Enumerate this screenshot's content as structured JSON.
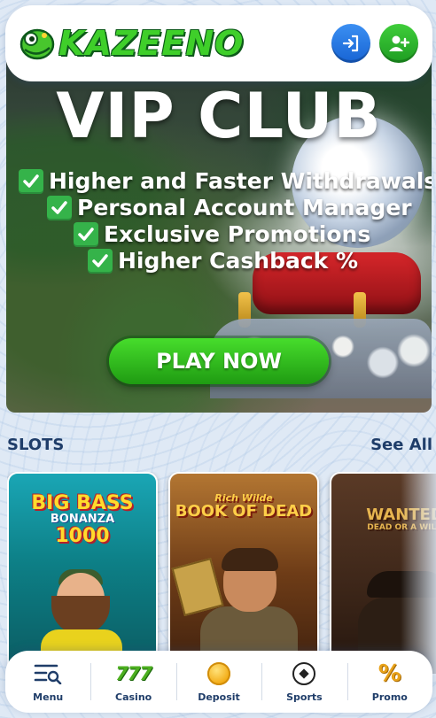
{
  "header": {
    "logo_text": "KAZEENO",
    "login_icon": "login-icon",
    "register_icon": "add-user-icon"
  },
  "banner": {
    "title": "VIP CLUB",
    "benefits": [
      "Higher and Faster  Withdrawals",
      "Personal  Account Manager",
      "Exclusive  Promotions",
      "Higher  Cashback %"
    ],
    "cta_label": "PLAY NOW"
  },
  "slots": {
    "section_title": "SLOTS",
    "see_all_label": "See All",
    "games": [
      {
        "title_line1": "BIG BASS",
        "title_line2": "BONANZA",
        "title_line3": "1000"
      },
      {
        "title_line1": "Rich Wilde",
        "title_line2": "BOOK OF DEAD"
      },
      {
        "title_line1": "WANTED",
        "title_line2": "DEAD OR A WILD"
      }
    ]
  },
  "bottom_nav": {
    "items": [
      {
        "label": "Menu",
        "icon": "menu-search-icon"
      },
      {
        "label": "Casino",
        "icon": "sevens-icon",
        "glyph": "777"
      },
      {
        "label": "Deposit",
        "icon": "coin-icon"
      },
      {
        "label": "Sports",
        "icon": "soccer-ball-icon"
      },
      {
        "label": "Promo",
        "icon": "percent-icon",
        "glyph": "%"
      }
    ]
  },
  "colors": {
    "brand_green": "#3fcf2a",
    "nav_text": "#1f3d69",
    "login_blue": "#1764d4",
    "register_green": "#1e9d22"
  }
}
